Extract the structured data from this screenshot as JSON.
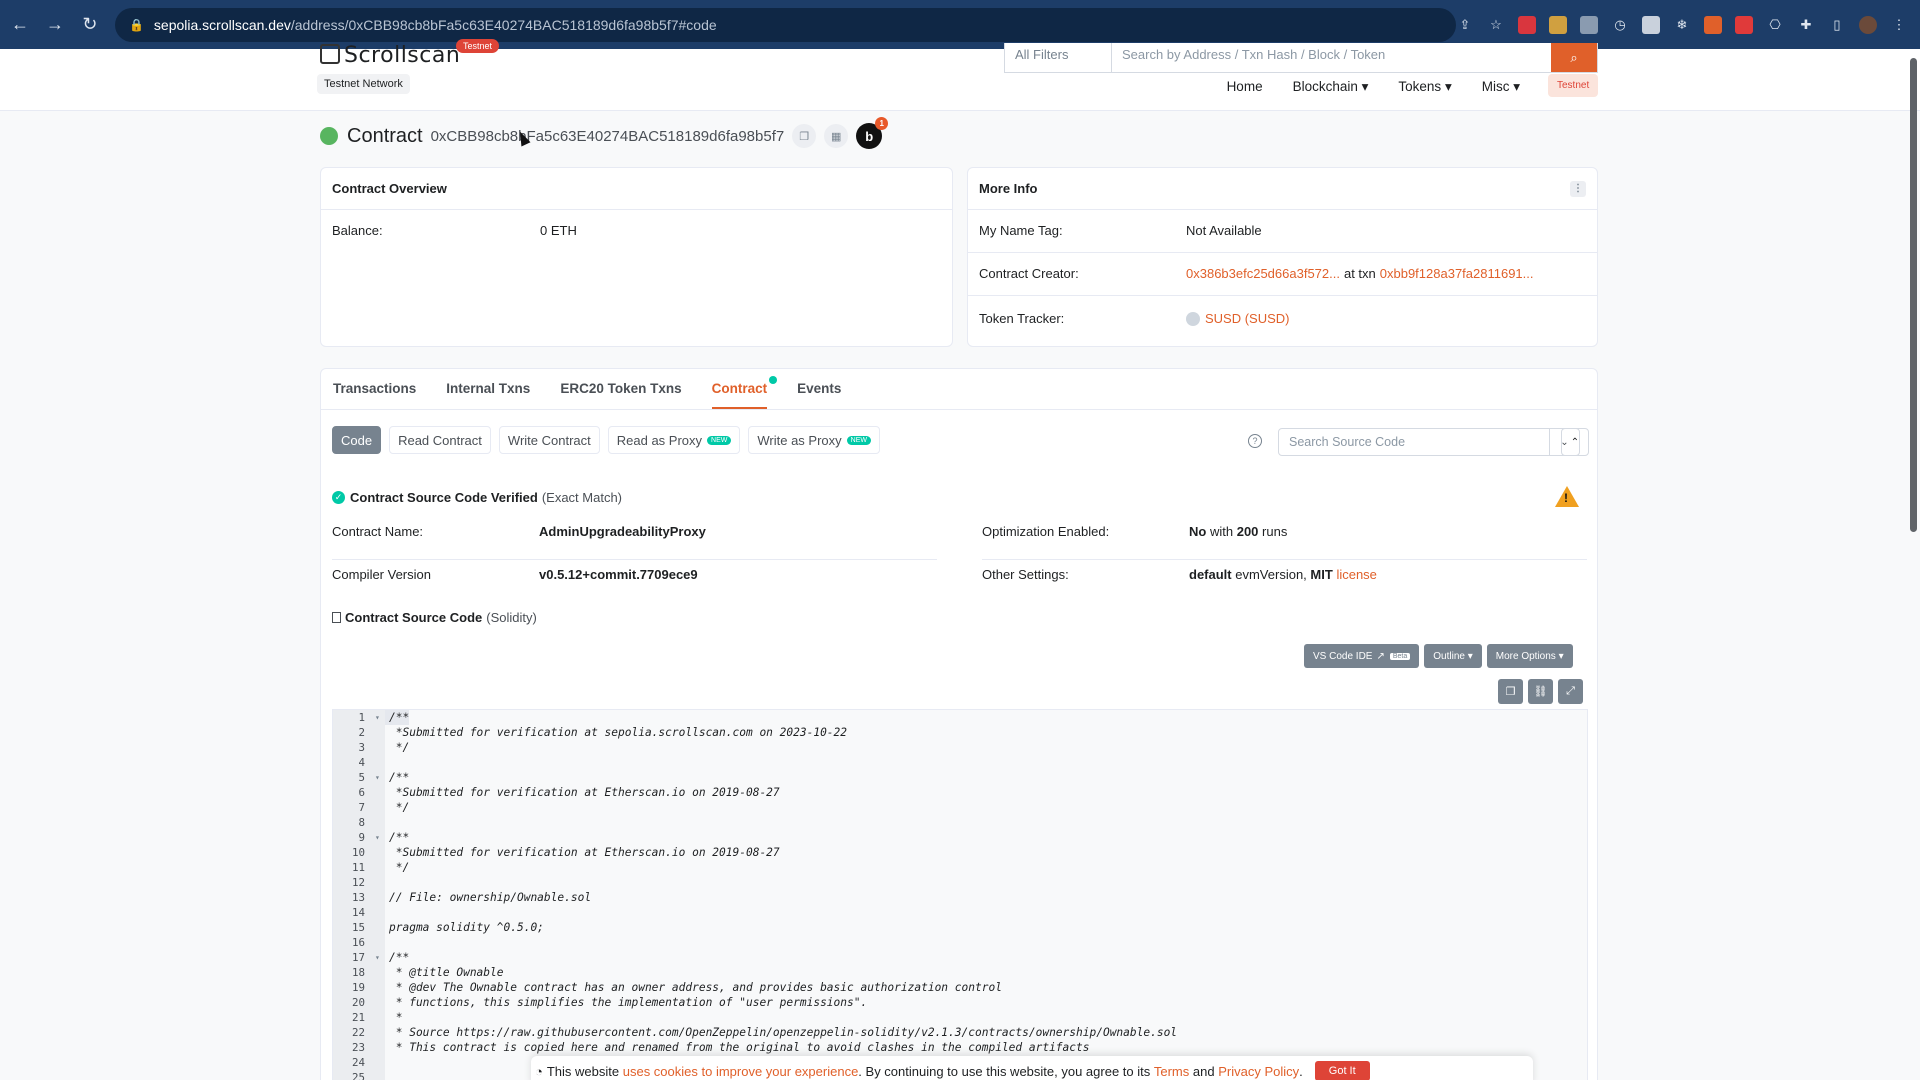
{
  "browser": {
    "url_host": "sepolia.scrollscan.dev",
    "url_path": "/address/0xCBB98cb8bFa5c63E40274BAC518189d6fa98b5f7#code",
    "icons": [
      "back-icon",
      "forward-icon",
      "reload-icon",
      "lock-icon",
      "share-icon",
      "star-icon",
      "extension-icon",
      "puzzle-icon",
      "sidebar-icon",
      "avatar",
      "more-icon"
    ]
  },
  "header": {
    "logo": "Scrollscan",
    "testnet_badge": "Testnet",
    "network": "Testnet Network",
    "filter": "All Filters",
    "search_placeholder": "Search by Address / Txn Hash / Block / Token",
    "menu": [
      "Home",
      "Blockchain",
      "Tokens",
      "Misc"
    ],
    "testnet_pill": "Testnet"
  },
  "page": {
    "title": "Contract",
    "address": "0xCBB98cb8bFa5c63E40274BAC518189d6fa98b5f7",
    "notification_count": "1"
  },
  "overview": {
    "heading": "Contract Overview",
    "balance_label": "Balance:",
    "balance_value": "0 ETH"
  },
  "more_info": {
    "heading": "More Info",
    "name_tag_label": "My Name Tag:",
    "name_tag_value": "Not Available",
    "creator_label": "Contract Creator:",
    "creator_addr": "0x386b3efc25d66a3f572...",
    "creator_at": "at txn",
    "creator_txn": "0xbb9f128a37fa2811691...",
    "token_label": "Token Tracker:",
    "token_value": "SUSD (SUSD)"
  },
  "tabs": [
    "Transactions",
    "Internal Txns",
    "ERC20 Token Txns",
    "Contract",
    "Events"
  ],
  "subtabs": {
    "code": "Code",
    "read": "Read Contract",
    "write": "Write Contract",
    "read_proxy": "Read as Proxy",
    "write_proxy": "Write as Proxy",
    "new_badge": "NEW",
    "search_placeholder": "Search Source Code"
  },
  "verified": {
    "title": "Contract Source Code Verified",
    "suffix": "(Exact Match)"
  },
  "details": {
    "name_label": "Contract Name:",
    "name_value": "AdminUpgradeabilityProxy",
    "compiler_label": "Compiler Version",
    "compiler_value": "v0.5.12+commit.7709ece9",
    "opt_label": "Optimization Enabled:",
    "opt_no": "No",
    "opt_with": "with",
    "opt_runs": "200",
    "opt_runs_word": "runs",
    "other_label": "Other Settings:",
    "other_default": "default",
    "other_evm": "evmVersion,",
    "other_mit": "MIT",
    "other_license": "license"
  },
  "source": {
    "heading": "Contract Source Code",
    "lang": "(Solidity)",
    "vscode": "VS Code IDE",
    "beta": "Beta",
    "outline": "Outline",
    "more_options": "More Options",
    "lines": [
      {
        "n": "1",
        "fold": "▾",
        "t": "/**"
      },
      {
        "n": "2",
        "fold": "",
        "t": " *Submitted for verification at sepolia.scrollscan.com on 2023-10-22"
      },
      {
        "n": "3",
        "fold": "",
        "t": " */"
      },
      {
        "n": "4",
        "fold": "",
        "t": ""
      },
      {
        "n": "5",
        "fold": "▾",
        "t": "/**"
      },
      {
        "n": "6",
        "fold": "",
        "t": " *Submitted for verification at Etherscan.io on 2019-08-27"
      },
      {
        "n": "7",
        "fold": "",
        "t": " */"
      },
      {
        "n": "8",
        "fold": "",
        "t": ""
      },
      {
        "n": "9",
        "fold": "▾",
        "t": "/**"
      },
      {
        "n": "10",
        "fold": "",
        "t": " *Submitted for verification at Etherscan.io on 2019-08-27"
      },
      {
        "n": "11",
        "fold": "",
        "t": " */"
      },
      {
        "n": "12",
        "fold": "",
        "t": ""
      },
      {
        "n": "13",
        "fold": "",
        "t": "// File: ownership/Ownable.sol"
      },
      {
        "n": "14",
        "fold": "",
        "t": ""
      },
      {
        "n": "15",
        "fold": "",
        "t": "pragma solidity ^0.5.0;"
      },
      {
        "n": "16",
        "fold": "",
        "t": ""
      },
      {
        "n": "17",
        "fold": "▾",
        "t": "/**"
      },
      {
        "n": "18",
        "fold": "",
        "t": " * @title Ownable"
      },
      {
        "n": "19",
        "fold": "",
        "t": " * @dev The Ownable contract has an owner address, and provides basic authorization control"
      },
      {
        "n": "20",
        "fold": "",
        "t": " * functions, this simplifies the implementation of \"user permissions\"."
      },
      {
        "n": "21",
        "fold": "",
        "t": " *"
      },
      {
        "n": "22",
        "fold": "",
        "t": " * Source https://raw.githubusercontent.com/OpenZeppelin/openzeppelin-solidity/v2.1.3/contracts/ownership/Ownable.sol"
      },
      {
        "n": "23",
        "fold": "",
        "t": " * This contract is copied here and renamed from the original to avoid clashes in the compiled artifacts"
      },
      {
        "n": "24",
        "fold": "",
        "t": ""
      },
      {
        "n": "25",
        "fold": "",
        "t": ""
      }
    ]
  },
  "cookie": {
    "pre": "This website",
    "link1": "uses cookies to improve your experience",
    "mid": ". By continuing to use this website, you agree to its",
    "terms": "Terms",
    "and": "and",
    "privacy": "Privacy Policy",
    "dot": ".",
    "button": "Got It"
  }
}
